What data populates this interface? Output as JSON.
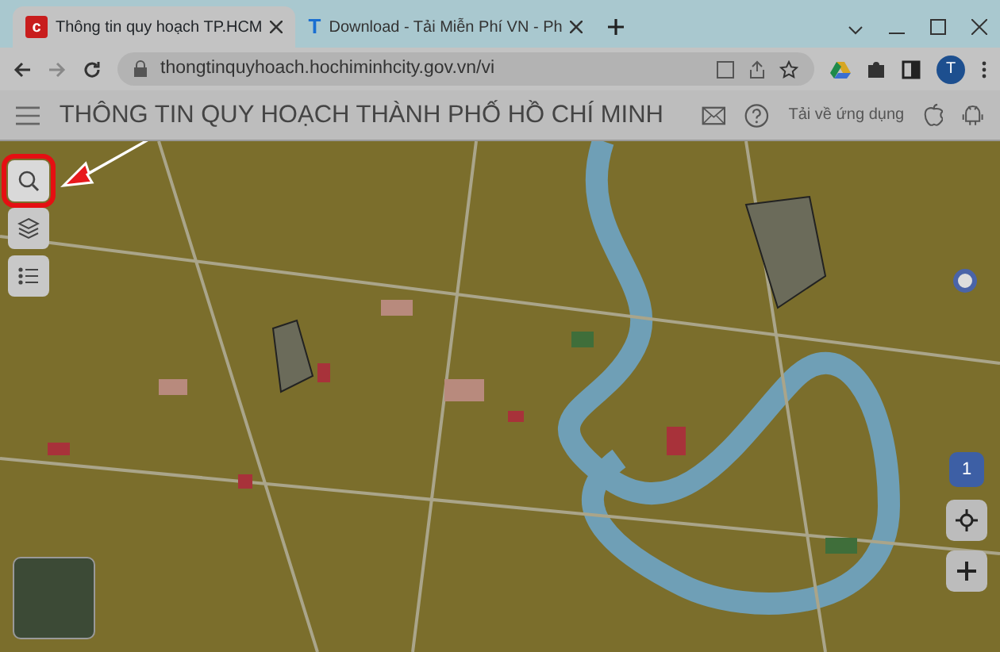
{
  "tabs": [
    {
      "title": "Thông tin quy hoạch TP.HCM",
      "selected": true,
      "icon": "c"
    },
    {
      "title": "Download - Tải Miễn Phí VN - Ph",
      "selected": false,
      "icon": "T"
    }
  ],
  "address": "thongtinquyhoach.hochiminhcity.gov.vn/vi",
  "profile": "T",
  "app": {
    "title": "THÔNG TIN QUY HOẠCH THÀNH PHỐ HỒ CHÍ MINH",
    "download_label": "Tải về ứng dụng"
  },
  "map": {
    "tools": [
      {
        "kind": "search",
        "highlighted": true
      },
      {
        "kind": "layers",
        "highlighted": false
      },
      {
        "kind": "list",
        "highlighted": false
      }
    ],
    "badge": "1"
  }
}
